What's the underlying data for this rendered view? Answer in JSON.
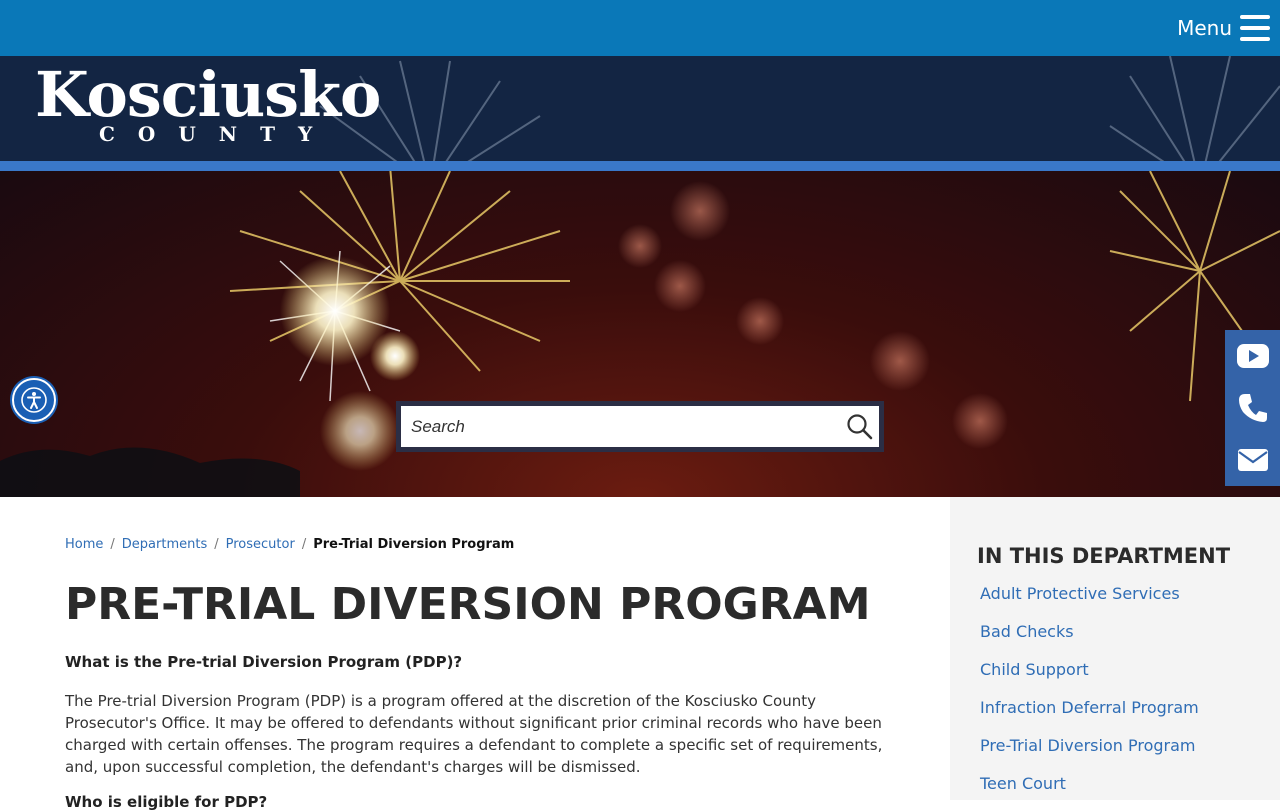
{
  "header": {
    "menu_label": "Menu"
  },
  "banner": {
    "logo_main": "Kosciusko",
    "logo_sub": "COUNTY"
  },
  "search": {
    "placeholder": "Search"
  },
  "social": [
    "youtube-icon",
    "phone-icon",
    "envelope-icon"
  ],
  "breadcrumb": {
    "items": [
      "Home",
      "Departments",
      "Prosecutor"
    ],
    "current": "Pre-Trial Diversion Program"
  },
  "main": {
    "title": "PRE-TRIAL DIVERSION PROGRAM",
    "question1": "What is the Pre-trial Diversion Program (PDP)?",
    "paragraph1": "The Pre-trial Diversion Program (PDP) is a program offered at the discretion of the Kosciusko County Prosecutor's Office.  It may be offered to defendants without significant prior criminal records who have been charged with certain offenses.  The program requires a defendant to complete a specific set of requirements, and, upon successful completion, the defendant's charges will be dismissed.",
    "question2": "Who is eligible for PDP?"
  },
  "sidebar": {
    "title": "IN THIS DEPARTMENT",
    "links": [
      "Adult Protective Services",
      "Bad Checks",
      "Child Support",
      "Infraction Deferral Program",
      "Pre-Trial Diversion Program",
      "Teen Court"
    ]
  },
  "colors": {
    "topbar": "#0a78b8",
    "banner": "#132543",
    "stripe": "#3a78c9",
    "link": "#2f6db5",
    "social_bar": "#3463a8"
  }
}
